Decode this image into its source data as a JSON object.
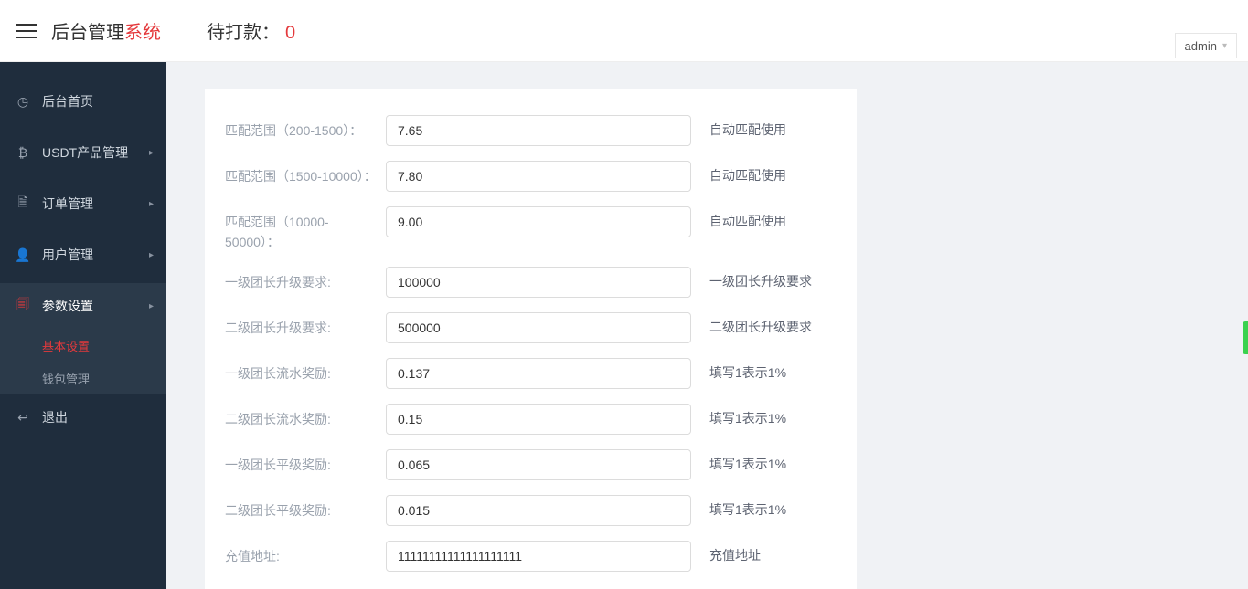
{
  "header": {
    "brand_black": "后台管理",
    "brand_red": "系统",
    "pending_label": "待打款：",
    "pending_value": "0",
    "user_label": "admin"
  },
  "sidebar": {
    "items": [
      {
        "icon": "dashboard-icon",
        "glyph": "◷",
        "label": "后台首页",
        "has_arrow": false
      },
      {
        "icon": "bitcoin-icon",
        "glyph": "₿",
        "label": "USDT产品管理",
        "has_arrow": true
      },
      {
        "icon": "orders-icon",
        "glyph": "🗎",
        "label": "订单管理",
        "has_arrow": true
      },
      {
        "icon": "user-icon",
        "glyph": "👤",
        "label": "用户管理",
        "has_arrow": true
      },
      {
        "icon": "settings-icon",
        "glyph": "🗐",
        "label": "参数设置",
        "has_arrow": true,
        "active": true,
        "sub": [
          {
            "label": "基本设置",
            "selected": true
          },
          {
            "label": "钱包管理",
            "selected": false
          }
        ]
      },
      {
        "icon": "logout-icon",
        "glyph": "↩",
        "label": "退出",
        "has_arrow": false
      }
    ]
  },
  "form": {
    "rows": [
      {
        "label": "匹配范围（200-1500）：",
        "value": "7.65",
        "help": "自动匹配使用"
      },
      {
        "label": "匹配范围（1500-10000）：",
        "value": "7.80",
        "help": "自动匹配使用"
      },
      {
        "label": "匹配范围（10000-50000）：",
        "value": "9.00",
        "help": "自动匹配使用"
      },
      {
        "label": "一级团长升级要求:",
        "value": "100000",
        "help": "一级团长升级要求"
      },
      {
        "label": "二级团长升级要求:",
        "value": "500000",
        "help": "二级团长升级要求"
      },
      {
        "label": "一级团长流水奖励:",
        "value": "0.137",
        "help": "填写1表示1%"
      },
      {
        "label": "二级团长流水奖励:",
        "value": "0.15",
        "help": "填写1表示1%"
      },
      {
        "label": "一级团长平级奖励:",
        "value": "0.065",
        "help": "填写1表示1%"
      },
      {
        "label": "二级团长平级奖励:",
        "value": "0.015",
        "help": "填写1表示1%"
      },
      {
        "label": "充值地址:",
        "value": "11111111111111111111",
        "help": "充值地址"
      }
    ]
  }
}
